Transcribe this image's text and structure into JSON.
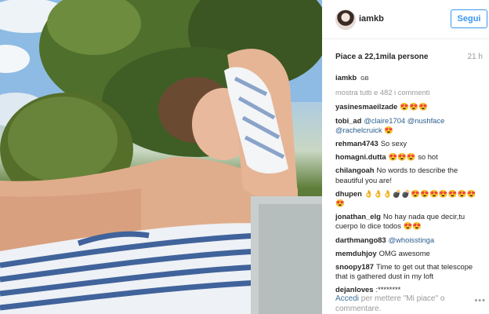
{
  "post": {
    "photo_icon": "photo-image",
    "author": {
      "username": "iamkb",
      "badge": "GB",
      "avatar_icon": "profile-avatar"
    },
    "follow_label": "Segui",
    "likes_text": "Piace a 22,1mila persone",
    "time_ago": "21 h",
    "more_comments": "mostra tutti e 482 i commenti"
  },
  "comments": [
    {
      "user": "yasinesmaeilzade",
      "text": "😍😍😍"
    },
    {
      "user": "tobi_ad",
      "text": "@claire1704 @nushface @rachelcruick 😍"
    },
    {
      "user": "rehman4743",
      "text": "So sexy"
    },
    {
      "user": "homagni.dutta",
      "text": "😍😍😍 so hot"
    },
    {
      "user": "chilangoah",
      "text": "No words to describe the beautiful you are!"
    },
    {
      "user": "dhupen",
      "text": "👌👌👌💣💣😍😍😍😍😍😍😍😍"
    },
    {
      "user": "jonathan_elg",
      "text": "No hay nada que decir,tu cuerpo lo dice todos 😍😍"
    },
    {
      "user": "darthmango83",
      "text": "@whoisstinga"
    },
    {
      "user": "memduhjoy",
      "text": "OMG awesome"
    },
    {
      "user": "snoopy187",
      "text": "Time to get out that telescope that is gathered dust in my loft"
    },
    {
      "user": "dejanloves",
      "text": ":********"
    }
  ],
  "footer": {
    "login_link": "Accedi",
    "login_text": " per mettere \"Mi piace\" o commentare.",
    "more_icon": "ellipsis-icon"
  },
  "colors": {
    "accent": "#3897f0",
    "link": "#3f729b",
    "muted": "#999999"
  }
}
